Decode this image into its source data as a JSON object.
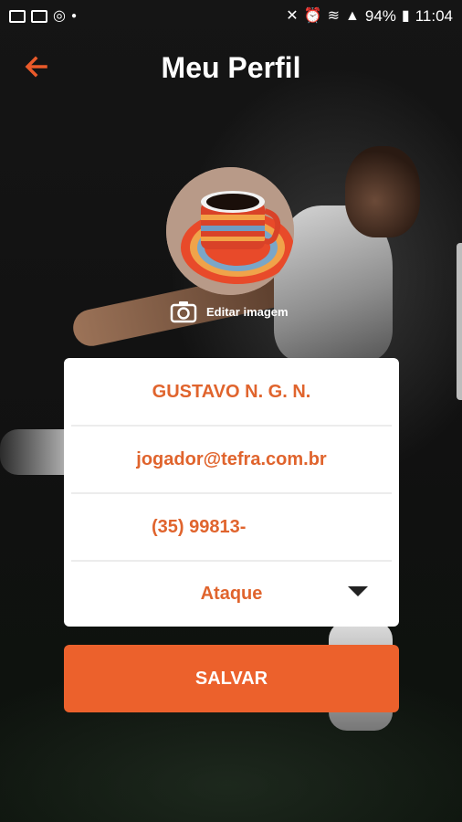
{
  "status_bar": {
    "battery": "94%",
    "time": "11:04",
    "left_icons": [
      "image-icon",
      "mail-icon",
      "whatsapp-icon",
      "dot-icon"
    ],
    "right_icons": [
      "mute-icon",
      "alarm-icon",
      "wifi-icon",
      "signal-icon",
      "battery-icon"
    ]
  },
  "header": {
    "title": "Meu Perfil",
    "back_icon": "arrow-left-icon"
  },
  "profile": {
    "edit_image_label": "Editar imagem",
    "camera_icon": "camera-icon"
  },
  "form": {
    "name": "GUSTAVO N. G. N.",
    "email": "jogador@tefra.com.br",
    "phone": "(35) 99813-",
    "position": "Ataque",
    "dropdown_icon": "caret-down-icon"
  },
  "actions": {
    "save_label": "SALVAR"
  },
  "colors": {
    "accent": "#ec612c",
    "field_text": "#e0642d",
    "background": "#0e0e0e"
  }
}
